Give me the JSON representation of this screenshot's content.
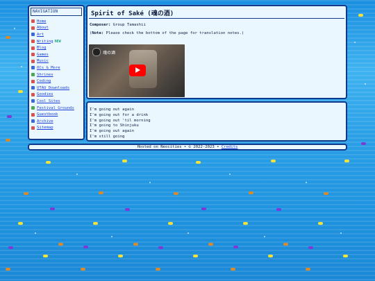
{
  "nav": {
    "header": "NAVIGATION",
    "items": [
      {
        "label": "Home",
        "icon": "home-icon",
        "color": "#d9534f"
      },
      {
        "label": "About",
        "icon": "person-icon",
        "color": "#d9534f"
      },
      {
        "label": "Art",
        "icon": "palette-icon",
        "color": "#3a6ad9"
      },
      {
        "label": "Writing",
        "icon": "pen-icon",
        "color": "#d9534f",
        "badge": "NEW"
      },
      {
        "label": "Blog",
        "icon": "journal-icon",
        "color": "#d9534f"
      },
      {
        "label": "Games",
        "icon": "controller-icon",
        "color": "#d9534f"
      },
      {
        "label": "Music",
        "icon": "music-icon",
        "color": "#d9534f"
      },
      {
        "label": "OCs & More",
        "icon": "character-icon",
        "color": "#3a6ad9"
      },
      {
        "label": "Shrines",
        "icon": "shrine-icon",
        "color": "#4aa84a"
      },
      {
        "label": "Coding",
        "icon": "code-icon",
        "color": "#d9534f"
      },
      {
        "label": "UTAU Downloads",
        "icon": "download-icon",
        "color": "#3a6ad9"
      },
      {
        "label": "Goodies",
        "icon": "gift-icon",
        "color": "#d9534f"
      },
      {
        "label": "Cool Sites",
        "icon": "globe-icon",
        "color": "#3a6ad9"
      },
      {
        "label": "Festival Grounds",
        "icon": "flag-icon",
        "color": "#4aa84a"
      },
      {
        "label": "Guestbook",
        "icon": "book-icon",
        "color": "#d9534f"
      },
      {
        "label": "Archive",
        "icon": "archive-icon",
        "color": "#3a6ad9"
      },
      {
        "label": "Sitemap",
        "icon": "map-icon",
        "color": "#d9534f"
      }
    ]
  },
  "main": {
    "title": "Spirit of Saké (魂の酒)",
    "composer_label": "Composer:",
    "composer_value": "Group Tamashii",
    "note_open": "(",
    "note_label": "Note:",
    "note_text": "Please check the bottom of the page for translation notes.)",
    "video_title": "魂の酒"
  },
  "lyrics": [
    "I'm going out again",
    "I'm going out for a drink",
    "I'm going out 'til morning",
    "I'm going to Shinjuku",
    "I'm going out again",
    "I'm still going"
  ],
  "footer": {
    "text": "Hosted on Neocities • © 2022-2023 • ",
    "credits": "Credits"
  }
}
